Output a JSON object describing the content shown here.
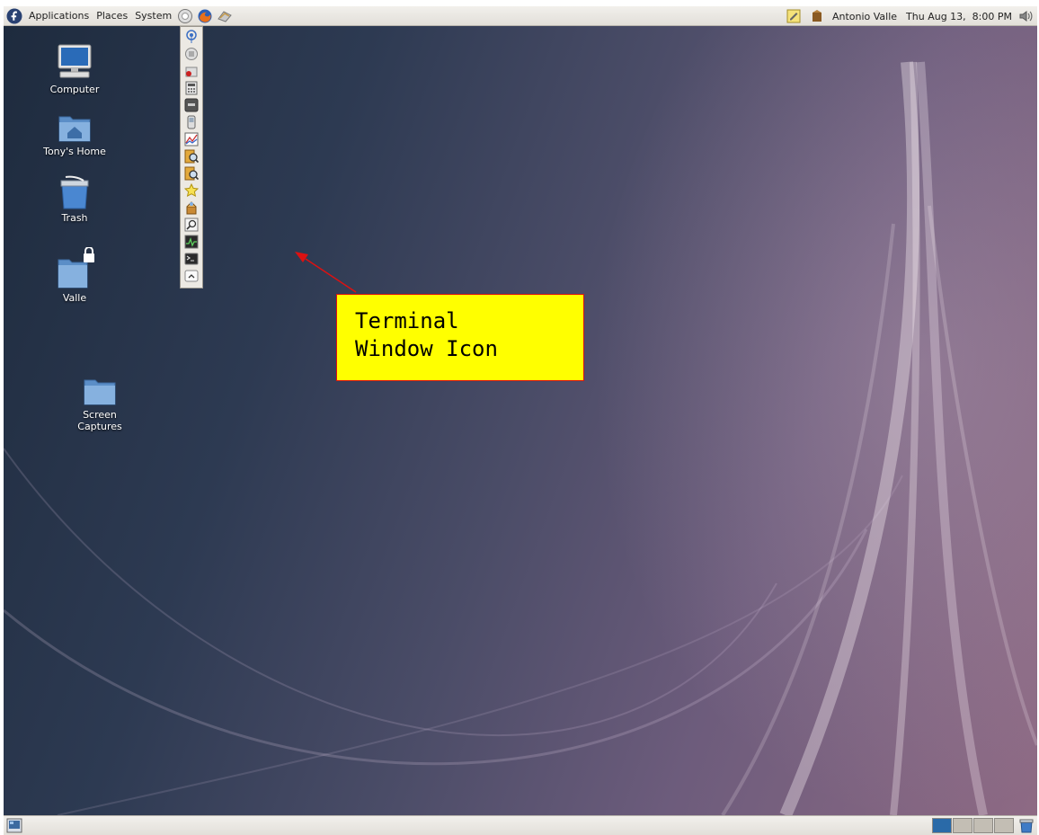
{
  "top_panel": {
    "menus": [
      "Applications",
      "Places",
      "System"
    ],
    "launchers": [
      "help-icon",
      "firefox-icon",
      "email-icon"
    ],
    "tray": {
      "notes_icon": "tomboy-notes-icon",
      "user_name": "Antonio Valle",
      "clock": "Thu Aug 13,  8:00 PM",
      "volume_icon": "volume-icon"
    }
  },
  "desktop_icons": [
    {
      "label": "Computer",
      "icon": "computer-icon"
    },
    {
      "label": "Tony's Home",
      "icon": "home-folder-icon"
    },
    {
      "label": "Trash",
      "icon": "trash-icon"
    },
    {
      "label": "Valle",
      "icon": "locked-folder-icon"
    },
    {
      "label": "Screen Captures",
      "icon": "folder-icon"
    }
  ],
  "drawer": {
    "items": [
      "network-icon",
      "connection-icon",
      "record-icon",
      "calculator-icon",
      "monitor-icon",
      "phone-icon",
      "chart-icon",
      "image-viewer-icon",
      "image-viewer-icon",
      "bookmark-star-icon",
      "package-icon",
      "search-icon",
      "system-monitor-icon",
      "terminal-icon",
      "drawer-collapse-icon"
    ]
  },
  "annotation": {
    "text": "Terminal\nWindow Icon",
    "fill_color": "#ffff00",
    "border_color": "#dd1111",
    "arrow_color": "#dd1111"
  },
  "bottom_panel": {
    "workspace_count": 4,
    "active_workspace": 1
  }
}
